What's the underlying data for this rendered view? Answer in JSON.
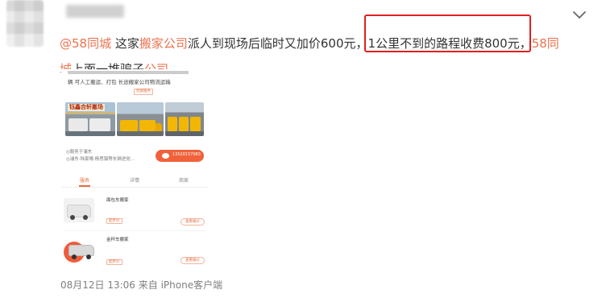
{
  "post": {
    "content": {
      "at_link": "@58同城",
      "seg1": " 这家",
      "kw1": "搬家公司",
      "seg2": "派人到现场后临时又加价600元，",
      "seg_highlight": "1公里不到的路程收费800元，",
      "link2_part1": "58同",
      "link2_part2": "城",
      "seg3": "上面一堆骗子",
      "kw2": "公司"
    },
    "embedded_image": {
      "service_line": "辆 可人工搬运、打包 长途搬家公司物流运输",
      "banner_text": "钰鑫合轩搬场",
      "tag_line": "优质服务",
      "address_line1": "◎服务于浦东",
      "address_line2": "◎浦东·陆家嘴·杨思镇等车辆进党...",
      "call_number": "13520157083",
      "tabs": [
        "服务",
        "详情",
        "商家"
      ],
      "items": [
        {
          "title": "面包车搬家",
          "tag": "起步价",
          "button": "查看报价"
        },
        {
          "title": "金杯车搬家",
          "tag": "起步价",
          "button": "查看报价"
        }
      ]
    },
    "footer": {
      "date": "08月12日 13:06",
      "source": "来自 iPhone客户端"
    }
  },
  "colors": {
    "link": "#eb7350",
    "highlight_border": "#e02020",
    "meta_text": "#808080",
    "call_button": "#f1613a"
  },
  "icons": {
    "menu": "chevron-down-icon",
    "phone": "phone-icon"
  }
}
